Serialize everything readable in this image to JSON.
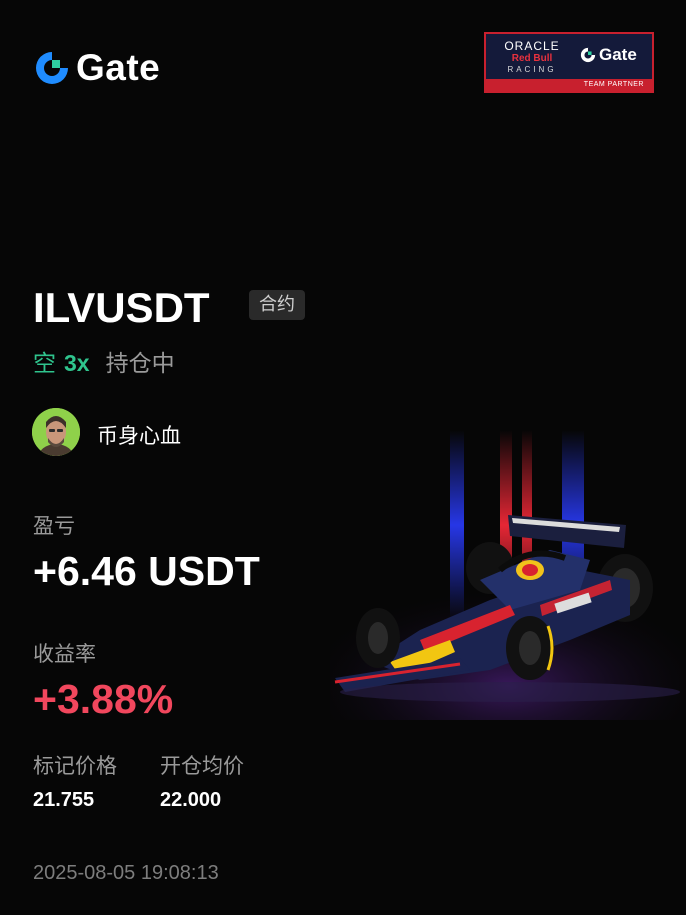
{
  "brand": {
    "name": "Gate",
    "accent": "#1f8cff",
    "accent2": "#2fd0a0"
  },
  "partner": {
    "oracle": "ORACLE",
    "redbull": "Red Bull",
    "racing": "RACING",
    "gate": "Gate",
    "footer": "TEAM PARTNER"
  },
  "position": {
    "pair": "ILVUSDT",
    "type_tag": "合约",
    "side": "空",
    "leverage": "3x",
    "status": "持仓中"
  },
  "user": {
    "name": "币身心血"
  },
  "stats": {
    "pnl_label": "盈亏",
    "pnl_value": "+6.46 USDT",
    "roi_label": "收益率",
    "roi_value": "+3.88%",
    "mark_price_label": "标记价格",
    "mark_price_value": "21.755",
    "entry_price_label": "开仓均价",
    "entry_price_value": "22.000"
  },
  "timestamp": "2025-08-05 19:08:13",
  "colors": {
    "short": "#2fc48d",
    "profit": "#f1475d",
    "muted": "#9a9a9a"
  }
}
